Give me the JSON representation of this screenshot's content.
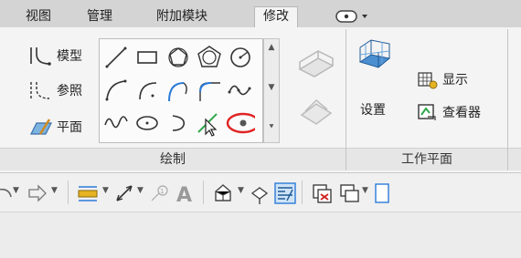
{
  "tabs": [
    {
      "label": "视图",
      "active": false
    },
    {
      "label": "管理",
      "active": false
    },
    {
      "label": "附加模块",
      "active": false
    },
    {
      "label": "修改",
      "active": true
    }
  ],
  "quick_access": {
    "icon": "dropdown-arrow-icon"
  },
  "draw_panel": {
    "title": "绘制",
    "mode_buttons": [
      {
        "label": "模型",
        "icon": "model-line-icon"
      },
      {
        "label": "参照",
        "icon": "reference-line-icon"
      },
      {
        "label": "平面",
        "icon": "pick-plane-icon"
      }
    ],
    "gallery_tools": [
      "line-icon",
      "rectangle-icon",
      "inscribed-polygon-icon",
      "circumscribed-polygon-icon",
      "circle-icon",
      "start-end-arc-icon",
      "center-ends-arc-icon",
      "tangent-arc-icon",
      "fillet-arc-icon",
      "spline-icon",
      "ellipse-icon",
      "half-ellipse-icon",
      "partial-ellipse-icon",
      "pick-lines-icon",
      "point-element-icon"
    ],
    "highlighted_tool": "point-element-icon"
  },
  "extra_tools": {
    "icons": [
      "extrude-disabled-icon",
      "blend-disabled-icon"
    ]
  },
  "work_plane_panel": {
    "title": "工作平面",
    "set_label": "设置",
    "show_label": "显示",
    "viewer_label": "查看器"
  },
  "toolbar2": {
    "icons": [
      "redo-icon",
      "measure-icon",
      "dimension-icon",
      "label-icon",
      "text-icon",
      "view-3d-icon",
      "camera-icon",
      "thin-lines-icon",
      "close-windows-icon",
      "switch-window-icon",
      "tile-icon"
    ]
  },
  "colors": {
    "highlight_ring": "#e02424",
    "tab_bar": "#d4d4d4",
    "ribbon_bg": "#f4f4f4"
  }
}
